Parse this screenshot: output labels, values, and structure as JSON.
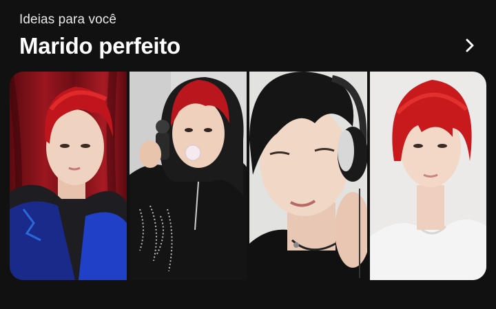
{
  "header": {
    "subtitle": "Ideias para você",
    "title": "Marido perfeito"
  },
  "icons": {
    "more": "chevron-right-icon"
  },
  "pins": [
    {
      "name": "pin-red-hair-red-curtain",
      "accent": "#a3121c"
    },
    {
      "name": "pin-red-hair-black-hoodie",
      "accent": "#b51820"
    },
    {
      "name": "pin-black-hair-headphones",
      "accent": "#1a1a1a"
    },
    {
      "name": "pin-red-hair-white-tshirt",
      "accent": "#c61e22"
    }
  ],
  "colors": {
    "background": "#111111",
    "text": "#ffffff"
  }
}
